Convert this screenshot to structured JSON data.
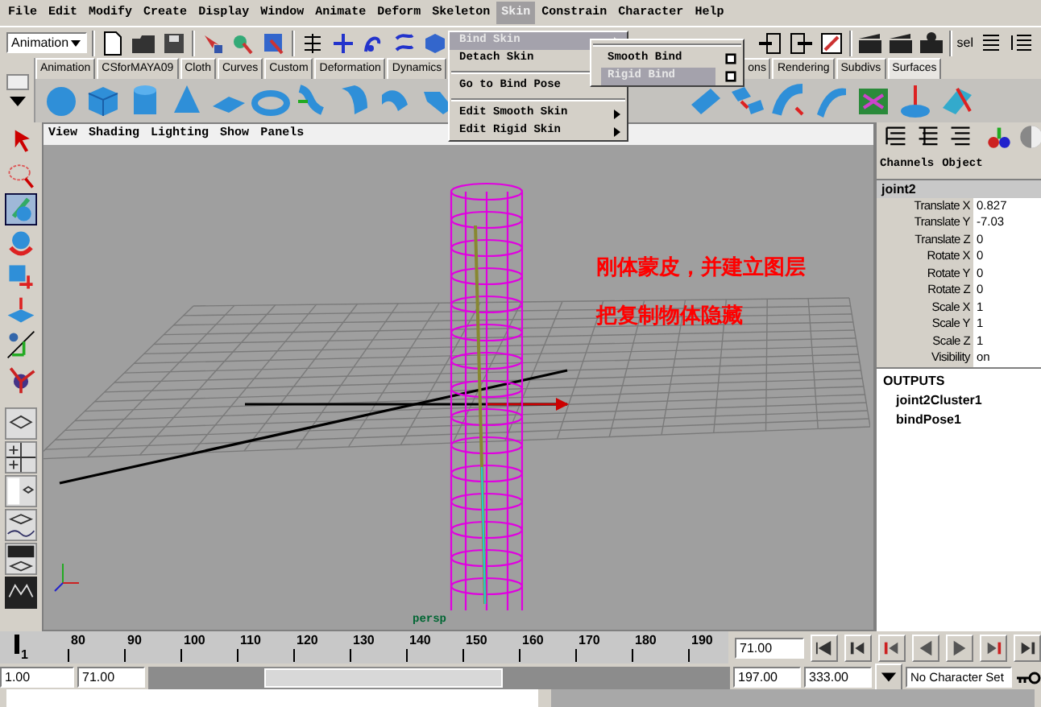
{
  "menu_bar": [
    {
      "label": "File",
      "selected": false
    },
    {
      "label": "Edit",
      "selected": false
    },
    {
      "label": "Modify",
      "selected": false
    },
    {
      "label": "Create",
      "selected": false
    },
    {
      "label": "Display",
      "selected": false
    },
    {
      "label": "Window",
      "selected": false
    },
    {
      "label": "Animate",
      "selected": false
    },
    {
      "label": "Deform",
      "selected": false
    },
    {
      "label": "Skeleton",
      "selected": false
    },
    {
      "label": "Skin",
      "selected": true
    },
    {
      "label": "Constrain",
      "selected": false
    },
    {
      "label": "Character",
      "selected": false
    },
    {
      "label": "Help",
      "selected": false
    }
  ],
  "skin_menu": {
    "groups": [
      [
        {
          "label": "Bind Skin",
          "kind": "submenu",
          "highlighted": true
        },
        {
          "label": "Detach Skin",
          "kind": "command",
          "highlighted": false
        }
      ],
      [
        {
          "label": "Go to Bind Pose",
          "kind": "command",
          "highlighted": false
        }
      ],
      [
        {
          "label": "Edit Smooth Skin",
          "kind": "submenu",
          "highlighted": false
        },
        {
          "label": "Edit Rigid Skin",
          "kind": "submenu",
          "highlighted": false
        }
      ]
    ]
  },
  "bind_skin_submenu": [
    {
      "label": "Smooth Bind",
      "selected": false
    },
    {
      "label": "Rigid Bind",
      "selected": true
    }
  ],
  "status_line": {
    "mode": "Animation",
    "selection_label": "sel"
  },
  "shelf_tabs": [
    {
      "label": "Animation",
      "selected": false
    },
    {
      "label": "CSforMAYA09",
      "selected": false
    },
    {
      "label": "Cloth",
      "selected": false
    },
    {
      "label": "Curves",
      "selected": false
    },
    {
      "label": "Custom",
      "selected": false
    },
    {
      "label": "Deformation",
      "selected": false
    },
    {
      "label": "Dynamics",
      "selected": false
    },
    {
      "label": "ons",
      "selected": false
    },
    {
      "label": "Rendering",
      "selected": false
    },
    {
      "label": "Subdivs",
      "selected": false
    },
    {
      "label": "Surfaces",
      "selected": true
    }
  ],
  "panel_menu": [
    "View",
    "Shading",
    "Lighting",
    "Show",
    "Panels"
  ],
  "viewport": {
    "annotations": [
      "刚体蒙皮，并建立图层",
      "把复制物体隐藏"
    ],
    "camera_label": "persp"
  },
  "channel_box": {
    "tabs": [
      "Channels",
      "Object"
    ],
    "node": "joint2",
    "attributes": [
      {
        "name": "Translate X",
        "value": "0.827"
      },
      {
        "name": "Translate Y",
        "value": "-7.03"
      },
      {
        "name": "Translate Z",
        "value": "0"
      },
      {
        "name": "Rotate X",
        "value": "0"
      },
      {
        "name": "Rotate Y",
        "value": "0"
      },
      {
        "name": "Rotate Z",
        "value": "0"
      },
      {
        "name": "Scale X",
        "value": "1"
      },
      {
        "name": "Scale Y",
        "value": "1"
      },
      {
        "name": "Scale Z",
        "value": "1"
      },
      {
        "name": "Visibility",
        "value": "on"
      }
    ],
    "outputs_heading": "OUTPUTS",
    "outputs": [
      "joint2Cluster1",
      "bindPose1"
    ]
  },
  "time_slider": {
    "current_marker_label": "1",
    "ticks": [
      "80",
      "90",
      "100",
      "110",
      "120",
      "130",
      "140",
      "150",
      "160",
      "170",
      "180",
      "190"
    ],
    "current_time": "71.00"
  },
  "range_slider": {
    "start": "1.00",
    "playback_start": "71.00",
    "playback_end": "197.00",
    "end": "333.00",
    "character_set": "No Character Set"
  }
}
